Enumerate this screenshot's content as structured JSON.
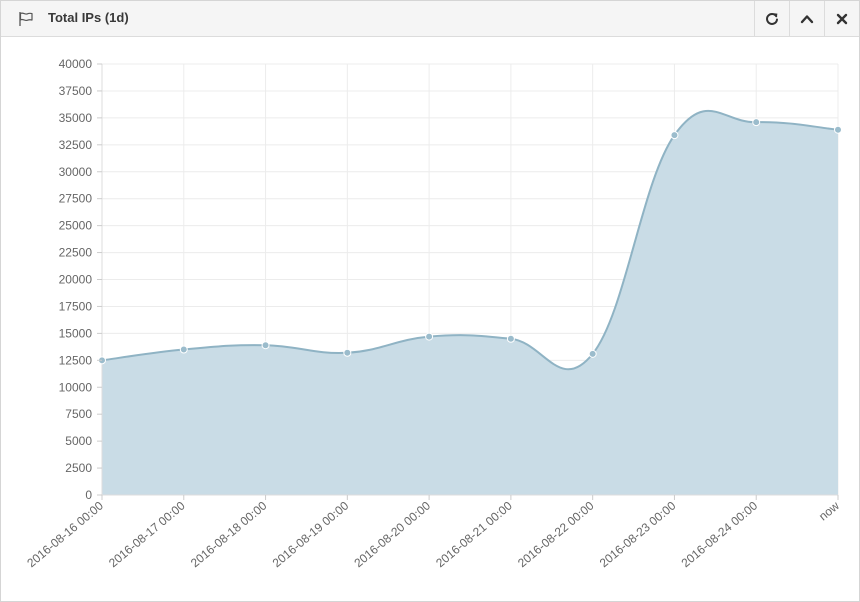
{
  "widget": {
    "title": "Total IPs (1d)",
    "icons": {
      "title_icon": "flag-icon",
      "refresh": "refresh-icon",
      "collapse": "chevron-up-icon",
      "close": "close-icon"
    }
  },
  "colors": {
    "area_fill": "#c9dce6",
    "line": "#8fb3c4",
    "point_fill": "#9bbccc",
    "grid": "#ececec",
    "axis_text": "#666666"
  },
  "chart_data": {
    "type": "area",
    "categories": [
      "2016-08-16 00:00",
      "2016-08-17 00:00",
      "2016-08-18 00:00",
      "2016-08-19 00:00",
      "2016-08-20 00:00",
      "2016-08-21 00:00",
      "2016-08-22 00:00",
      "2016-08-23 00:00",
      "2016-08-24 00:00",
      "now"
    ],
    "values": [
      12500,
      13500,
      13900,
      13200,
      14700,
      14500,
      13100,
      33400,
      34600,
      33900
    ],
    "yticks": [
      0,
      2500,
      5000,
      7500,
      10000,
      12500,
      15000,
      17500,
      20000,
      22500,
      25000,
      27500,
      30000,
      32500,
      35000,
      37500,
      40000
    ],
    "ylim": [
      0,
      40000
    ],
    "title": "",
    "xlabel": "",
    "ylabel": "",
    "grid": true,
    "legend": "none"
  }
}
